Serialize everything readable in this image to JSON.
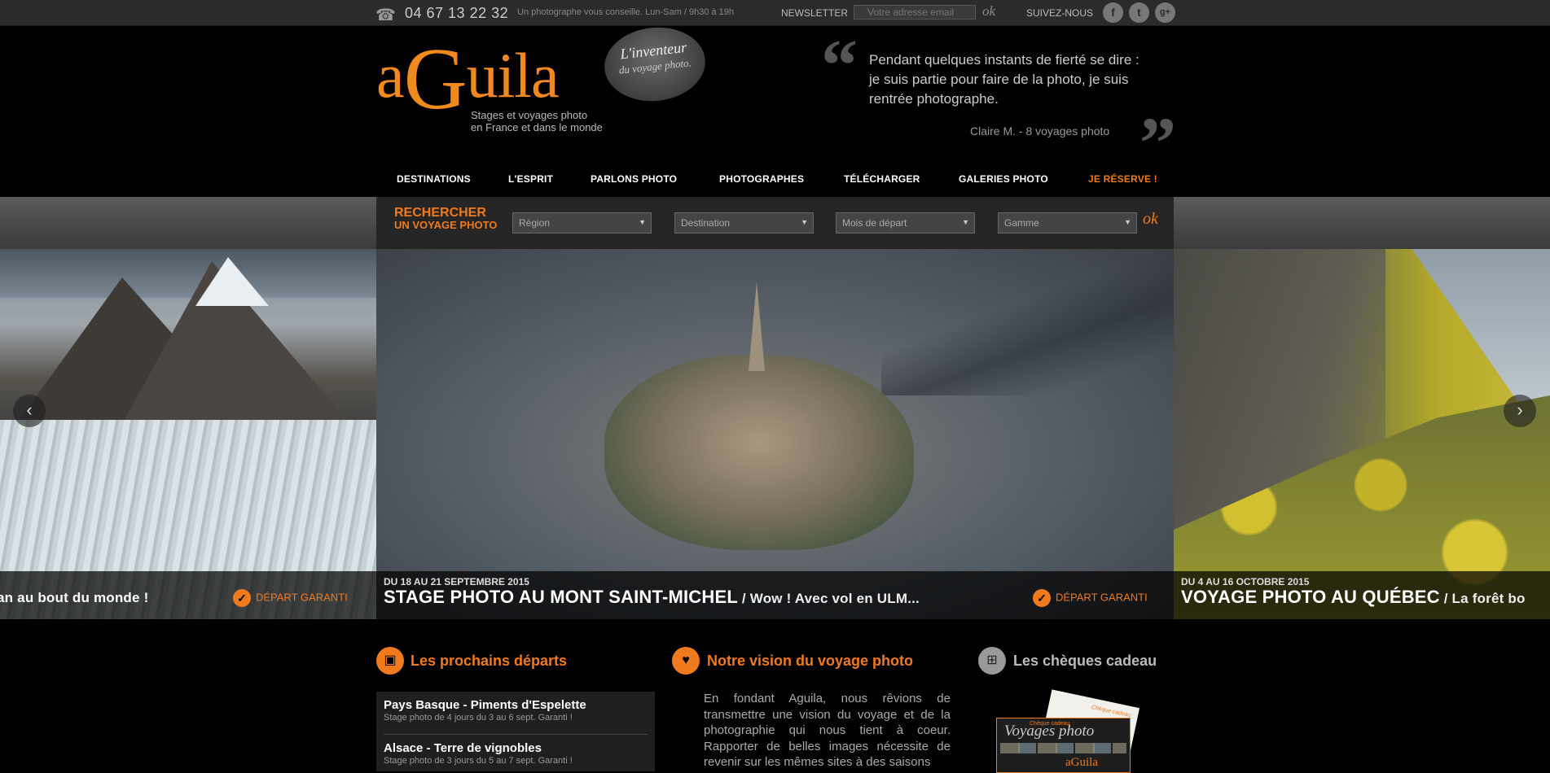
{
  "topbar": {
    "phone": "04 67 13 22 32",
    "hours": "Un photographe vous conseille. Lun-Sam / 9h30 à 19h",
    "newsletter_label": "NEWSLETTER",
    "newsletter_placeholder": "Votre adresse email",
    "newsletter_ok": "ok",
    "follow_label": "SUIVEZ-NOUS",
    "social": [
      {
        "icon": "facebook-icon",
        "glyph": "f"
      },
      {
        "icon": "twitter-icon",
        "glyph": "t"
      },
      {
        "icon": "google-plus-icon",
        "glyph": "g+"
      }
    ]
  },
  "header": {
    "logo": {
      "pre": "a",
      "g": "G",
      "post": "uila"
    },
    "tagline_1": "Stages et voyages photo",
    "tagline_2": "en France et dans le monde",
    "badge_1": "L'inventeur",
    "badge_2": "du voyage photo.",
    "quote": "Pendant quelques instants de fierté se dire : je suis partie pour faire de la photo, je suis rentrée photographe.",
    "quote_author": "Claire M. - 8 voyages photo"
  },
  "nav": [
    {
      "label": "DESTINATIONS",
      "hot": false
    },
    {
      "label": "L'ESPRIT",
      "hot": false
    },
    {
      "label": "PARLONS PHOTO",
      "hot": false
    },
    {
      "label": "PHOTOGRAPHES",
      "hot": false
    },
    {
      "label": "TÉLÉCHARGER",
      "hot": false
    },
    {
      "label": "GALERIES PHOTO",
      "hot": false
    },
    {
      "label": "JE RÉSERVE !",
      "hot": true
    }
  ],
  "search": {
    "title": "RECHERCHER",
    "subtitle": "UN VOYAGE PHOTO",
    "selects": [
      "Région",
      "Destination",
      "Mois de départ",
      "Gamme"
    ],
    "ok": "ok"
  },
  "slides": {
    "left": {
      "title_tail": "an au bout du monde !",
      "guarantee": "DÉPART GARANTI"
    },
    "center": {
      "date": "DU 18 AU 21 SEPTEMBRE 2015",
      "title": "STAGE PHOTO AU MONT SAINT-MICHEL",
      "rest": " / Wow ! Avec vol en ULM...",
      "guarantee": "DÉPART GARANTI"
    },
    "right": {
      "date": "DU 4 AU 16 OCTOBRE 2015",
      "title": "VOYAGE PHOTO AU QUÉBEC",
      "rest": " / La forêt bo"
    }
  },
  "sections": {
    "departs": {
      "title": "Les prochains départs",
      "items": [
        {
          "title": "Pays Basque - Piments d'Espelette",
          "sub": "Stage photo de 4 jours du 3 au 6 sept. Garanti !"
        },
        {
          "title": "Alsace - Terre de vignobles",
          "sub": "Stage photo de 3 jours du 5 au 7 sept. Garanti !"
        }
      ]
    },
    "vision": {
      "title": "Notre vision du voyage photo",
      "text": "En fondant Aguila, nous rêvions de transmettre une vision du voyage et de la photographie qui nous tient à coeur. Rapporter de belles images nécessite de revenir sur les mêmes sites à des saisons"
    },
    "cheques": {
      "title": "Les chèques cadeau",
      "card_small": "Chèque cadeau",
      "card_title": "Voyages photo",
      "card_logo": "aGuila",
      "back_label": "Chèque cadeau"
    }
  },
  "colors": {
    "accent": "#f07a1e",
    "bar": "#2b2b2b"
  }
}
